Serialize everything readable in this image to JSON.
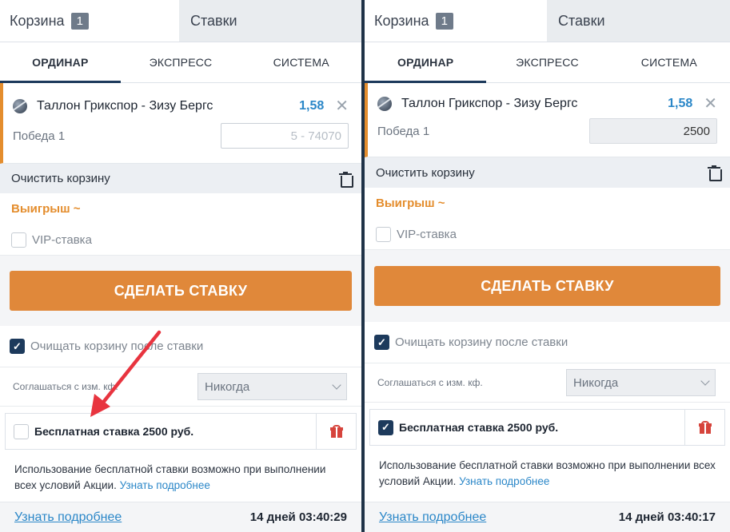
{
  "panels": [
    {
      "header": {
        "cart_label": "Корзина",
        "cart_count": "1",
        "bets_label": "Ставки"
      },
      "mode_tabs": [
        "ОРДИНАР",
        "ЭКСПРЕСС",
        "СИСТЕМА"
      ],
      "bet": {
        "match": "Таллон Грикспор - Зизу Бергс",
        "odds": "1,58",
        "outcome": "Победа 1",
        "stake_value": "",
        "stake_placeholder": "5 - 74070"
      },
      "clear_cart": "Очистить корзину",
      "winnings": "Выигрыш ~",
      "vip": {
        "label": "VIP-ставка",
        "checked": false
      },
      "make_bet": "СДЕЛАТЬ СТАВКУ",
      "clear_after": {
        "label": "Очищать корзину после ставки",
        "checked": true
      },
      "agree": {
        "label": "Соглашаться с изм. кф.",
        "value": "Никогда"
      },
      "free_bet": {
        "label": "Бесплатная ставка 2500 руб.",
        "checked": false
      },
      "info": {
        "text": "Использование бесплатной ставки возможно при выполнении всех условий Акции.",
        "link": "Узнать подробнее"
      },
      "footer": {
        "link": "Узнать подробнее",
        "timer": "14 дней 03:40:29"
      }
    },
    {
      "header": {
        "cart_label": "Корзина",
        "cart_count": "1",
        "bets_label": "Ставки"
      },
      "mode_tabs": [
        "ОРДИНАР",
        "ЭКСПРЕСС",
        "СИСТЕМА"
      ],
      "bet": {
        "match": "Таллон Грикспор - Зизу Бергс",
        "odds": "1,58",
        "outcome": "Победа 1",
        "stake_value": "2500",
        "stake_placeholder": ""
      },
      "clear_cart": "Очистить корзину",
      "winnings": "Выигрыш ~",
      "vip": {
        "label": "VIP-ставка",
        "checked": false
      },
      "make_bet": "СДЕЛАТЬ СТАВКУ",
      "clear_after": {
        "label": "Очищать корзину после ставки",
        "checked": true
      },
      "agree": {
        "label": "Соглашаться с изм. кф.",
        "value": "Никогда"
      },
      "free_bet": {
        "label": "Бесплатная ставка 2500 руб.",
        "checked": true
      },
      "info": {
        "text": "Использование бесплатной ставки возможно при выполнении всех условий Акции.",
        "link": "Узнать подробнее"
      },
      "footer": {
        "link": "Узнать подробнее",
        "timer": "14 дней 03:40:17"
      }
    }
  ],
  "colors": {
    "accent": "#e0883a",
    "link": "#2b87c8",
    "navy": "#1d3a5c",
    "annotation_arrow": "#e8343f"
  }
}
